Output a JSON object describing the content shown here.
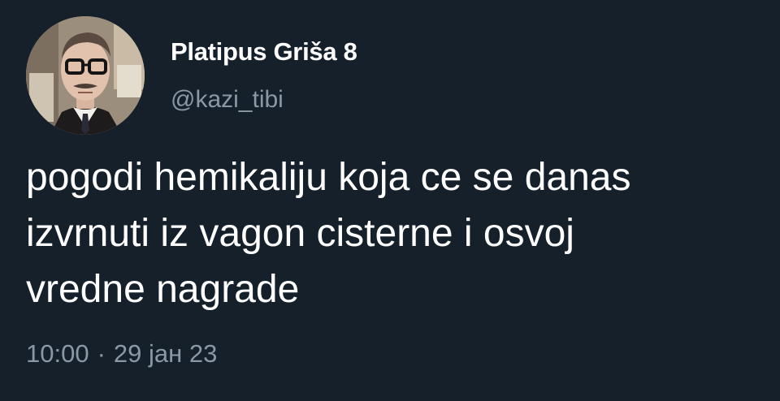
{
  "author": {
    "display_name": "Platipus Griša 8",
    "handle": "@kazi_tibi",
    "avatar_icon": "profile-photo-man-glasses-mustache"
  },
  "tweet": {
    "text": "pogodi hemikaliju koja ce se danas\nizvrnuti iz vagon cisterne i osvoj\nvredne nagrade",
    "time": "10:00",
    "separator": "·",
    "date": "29 јан 23"
  },
  "colors": {
    "background": "#15202b",
    "primary_text": "#ffffff",
    "secondary_text": "#8b98a5"
  }
}
